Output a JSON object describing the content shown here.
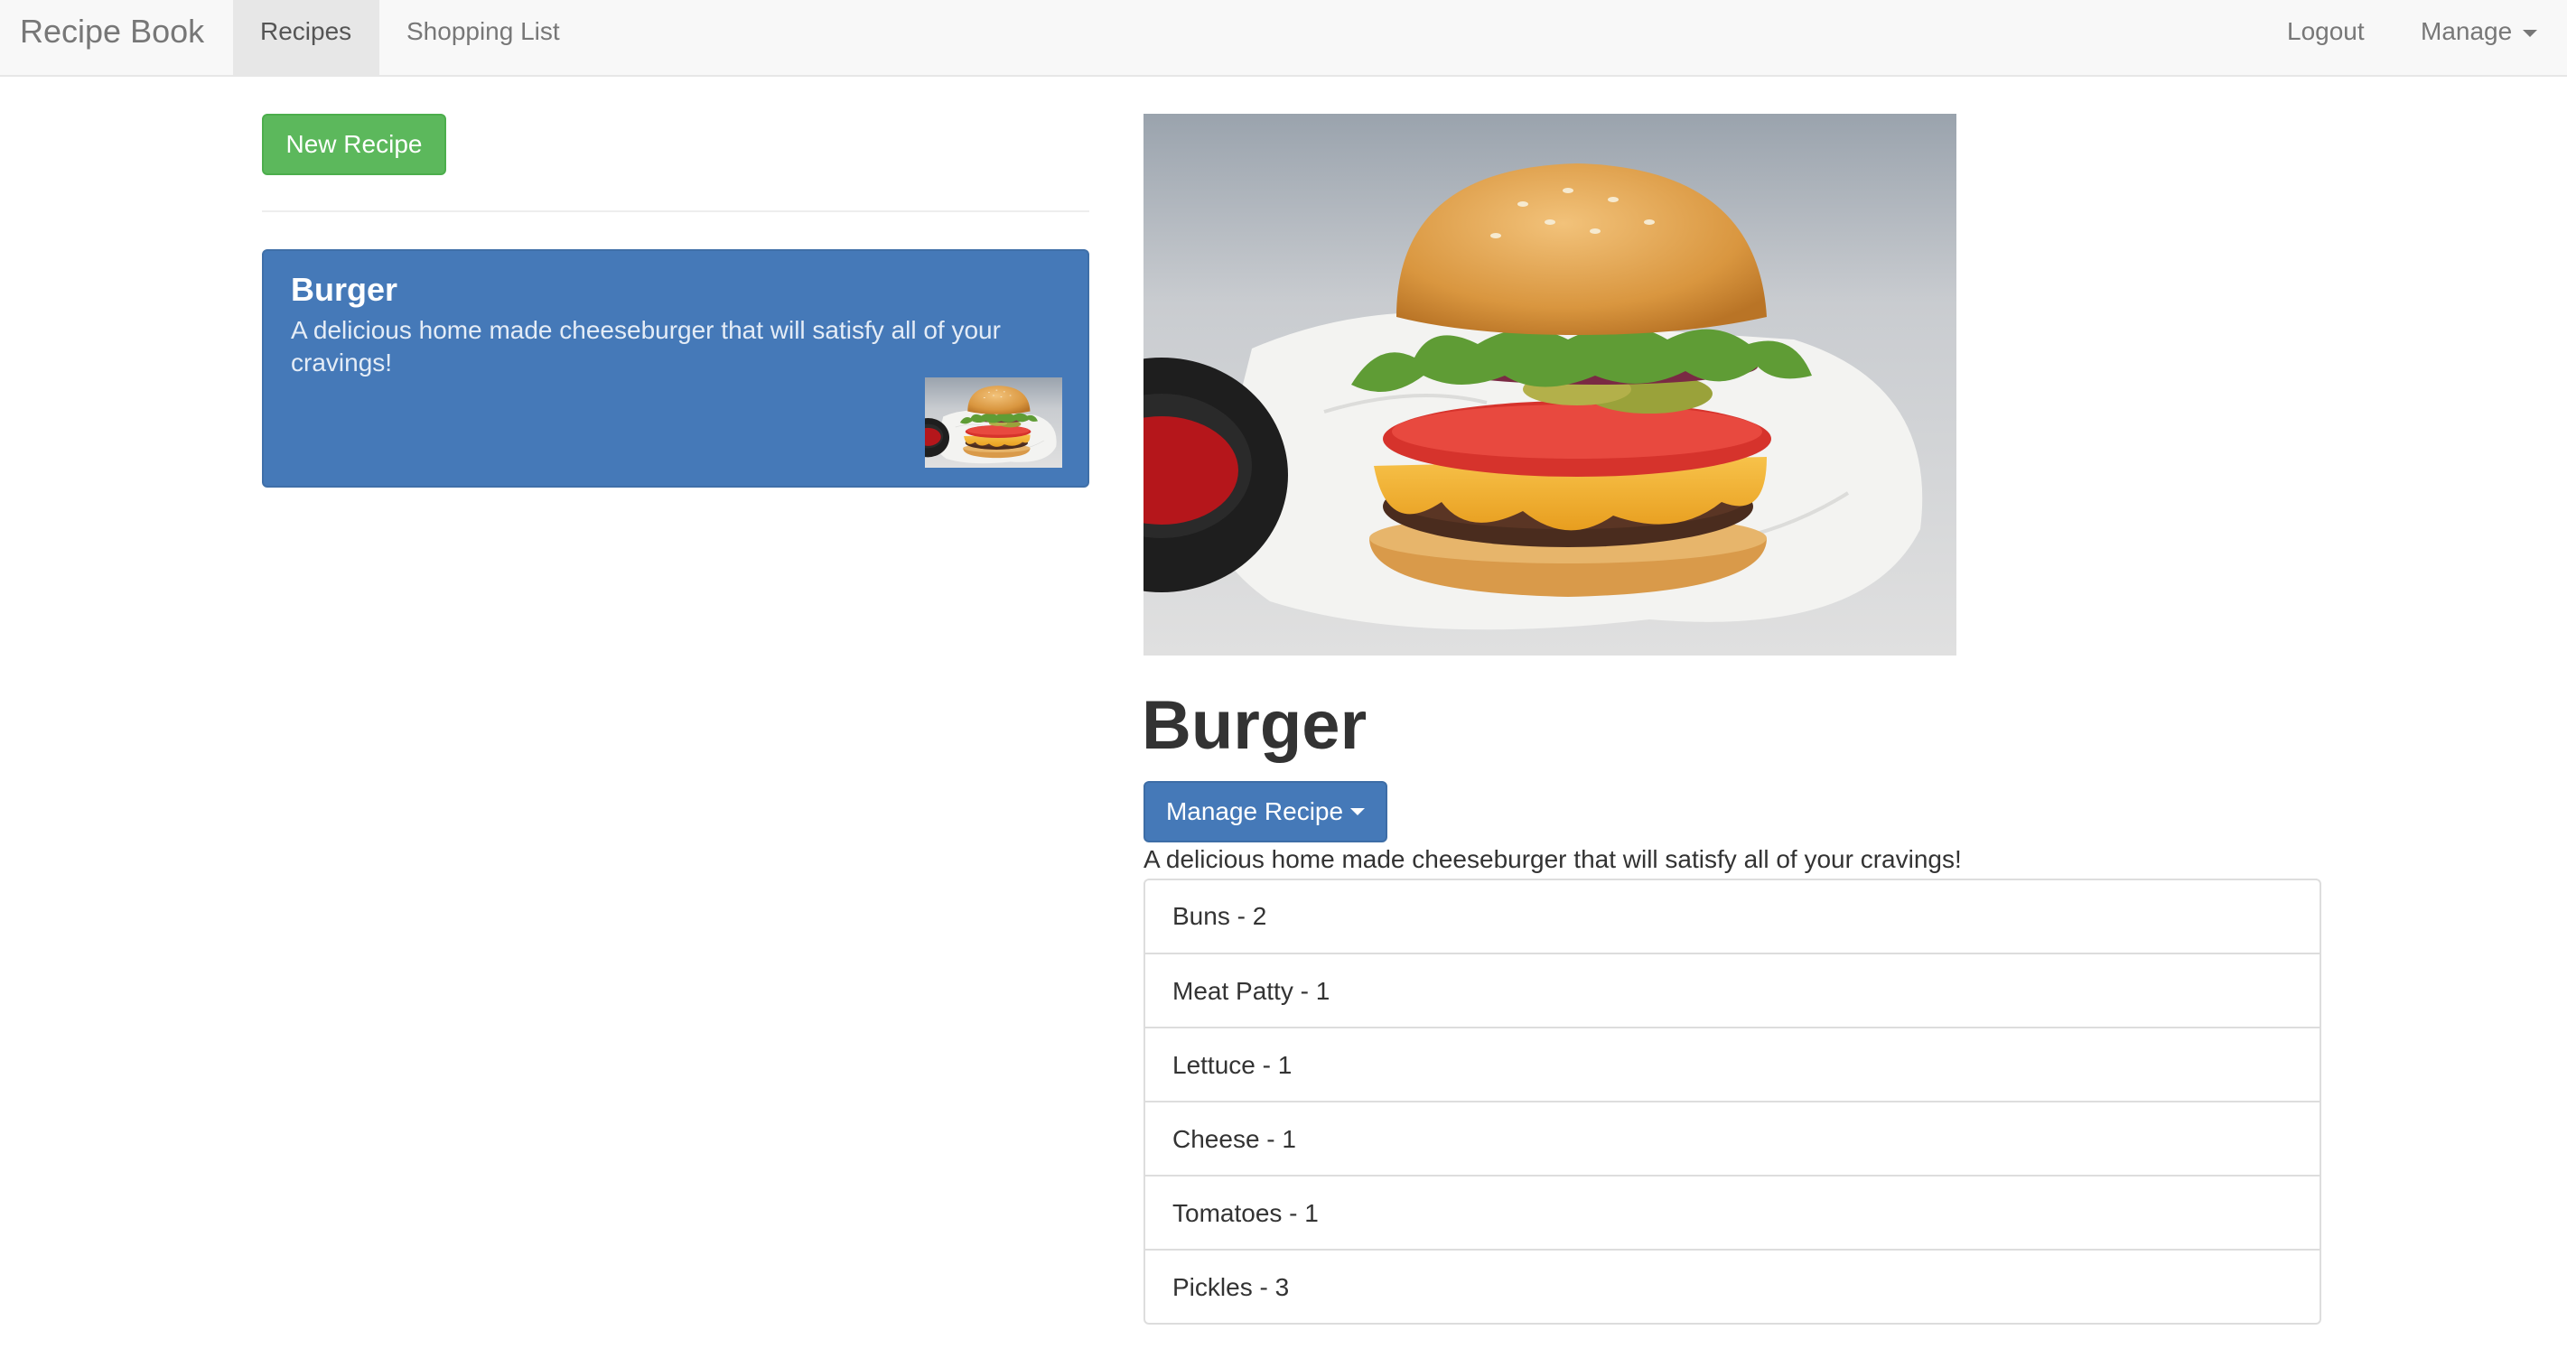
{
  "navbar": {
    "brand": "Recipe Book",
    "links": [
      {
        "label": "Recipes",
        "active": true
      },
      {
        "label": "Shopping List",
        "active": false
      }
    ],
    "right": {
      "logout": "Logout",
      "manage": "Manage"
    }
  },
  "sidebar": {
    "new_recipe_label": "New Recipe",
    "recipes": [
      {
        "name": "Burger",
        "description": "A delicious home made cheeseburger that will satisfy all of your cravings!",
        "thumbnail": "burger-photo"
      }
    ]
  },
  "detail": {
    "image": "burger-photo",
    "name": "Burger",
    "manage_label": "Manage Recipe",
    "description": "A delicious home made cheeseburger that will satisfy all of your cravings!",
    "ingredients": [
      "Buns - 2",
      "Meat Patty - 1",
      "Lettuce - 1",
      "Cheese - 1",
      "Tomatoes - 1",
      "Pickles - 3"
    ]
  },
  "colors": {
    "primary": "#4579b8",
    "success": "#5cb85c",
    "navbar_bg": "#f8f8f8"
  }
}
